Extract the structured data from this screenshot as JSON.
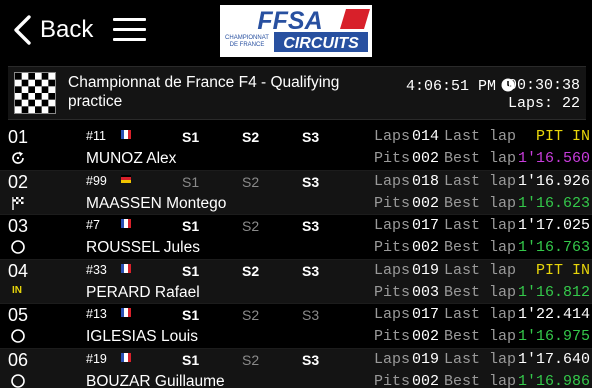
{
  "nav": {
    "back_label": "Back"
  },
  "logo": {
    "main": "FFSA",
    "sub_line1": "CHAMPIONNAT",
    "sub_line2": "DE FRANCE",
    "circuits": "CIRCUITS"
  },
  "session": {
    "title": "Championnat de France F4 - Qualifying practice",
    "time_of_day": "4:06:51 PM",
    "remaining": "00:30:38",
    "laps_text": "Laps: 22"
  },
  "labels": {
    "laps": "Laps",
    "pits": "Pits",
    "last_lap": "Last lap",
    "best_lap": "Best lap",
    "s1": "S1",
    "s2": "S2",
    "s3": "S3"
  },
  "colors": {
    "personal_best": "#34c84a",
    "overall_best": "#c83cdc",
    "pit": "#e8d60a"
  },
  "rows": [
    {
      "pos": "01",
      "status": "refresh-icon",
      "status_text": "",
      "car": "#11",
      "nationality": "FR",
      "driver": "MUNOZ Alex",
      "s1": "lit",
      "s2": "lit",
      "s3": "lit",
      "laps": "014",
      "last_lap": "PIT IN",
      "last_color": "#e8d60a",
      "pits": "002",
      "best_lap": "1'16.560",
      "best_color": "#c83cdc"
    },
    {
      "pos": "02",
      "status": "checkered-flag-icon",
      "status_text": "",
      "car": "#99",
      "nationality": "DE",
      "driver": "MAASSEN Montego",
      "s1": "dim",
      "s2": "dim",
      "s3": "lit",
      "laps": "018",
      "last_lap": "1'16.926",
      "last_color": "#ffffff",
      "pits": "002",
      "best_lap": "1'16.623",
      "best_color": "#34c84a"
    },
    {
      "pos": "03",
      "status": "circle-icon",
      "status_text": "",
      "car": "#7",
      "nationality": "FR",
      "driver": "ROUSSEL Jules",
      "s1": "lit",
      "s2": "dim",
      "s3": "lit",
      "laps": "017",
      "last_lap": "1'17.025",
      "last_color": "#ffffff",
      "pits": "002",
      "best_lap": "1'16.763",
      "best_color": "#34c84a"
    },
    {
      "pos": "04",
      "status": "in-badge",
      "status_text": "IN",
      "car": "#33",
      "nationality": "FR",
      "driver": "PERARD Rafael",
      "s1": "lit",
      "s2": "lit",
      "s3": "lit",
      "laps": "019",
      "last_lap": "PIT IN",
      "last_color": "#e8d60a",
      "pits": "003",
      "best_lap": "1'16.812",
      "best_color": "#34c84a"
    },
    {
      "pos": "05",
      "status": "circle-icon",
      "status_text": "",
      "car": "#13",
      "nationality": "FR",
      "driver": "IGLESIAS Louis",
      "s1": "lit",
      "s2": "dim",
      "s3": "dim",
      "laps": "017",
      "last_lap": "1'22.414",
      "last_color": "#ffffff",
      "pits": "002",
      "best_lap": "1'16.975",
      "best_color": "#34c84a"
    },
    {
      "pos": "06",
      "status": "circle-icon",
      "status_text": "",
      "car": "#19",
      "nationality": "FR",
      "driver": "BOUZAR Guillaume",
      "s1": "lit",
      "s2": "dim",
      "s3": "lit",
      "laps": "019",
      "last_lap": "1'17.640",
      "last_color": "#ffffff",
      "pits": "002",
      "best_lap": "1'16.986",
      "best_color": "#34c84a"
    }
  ]
}
